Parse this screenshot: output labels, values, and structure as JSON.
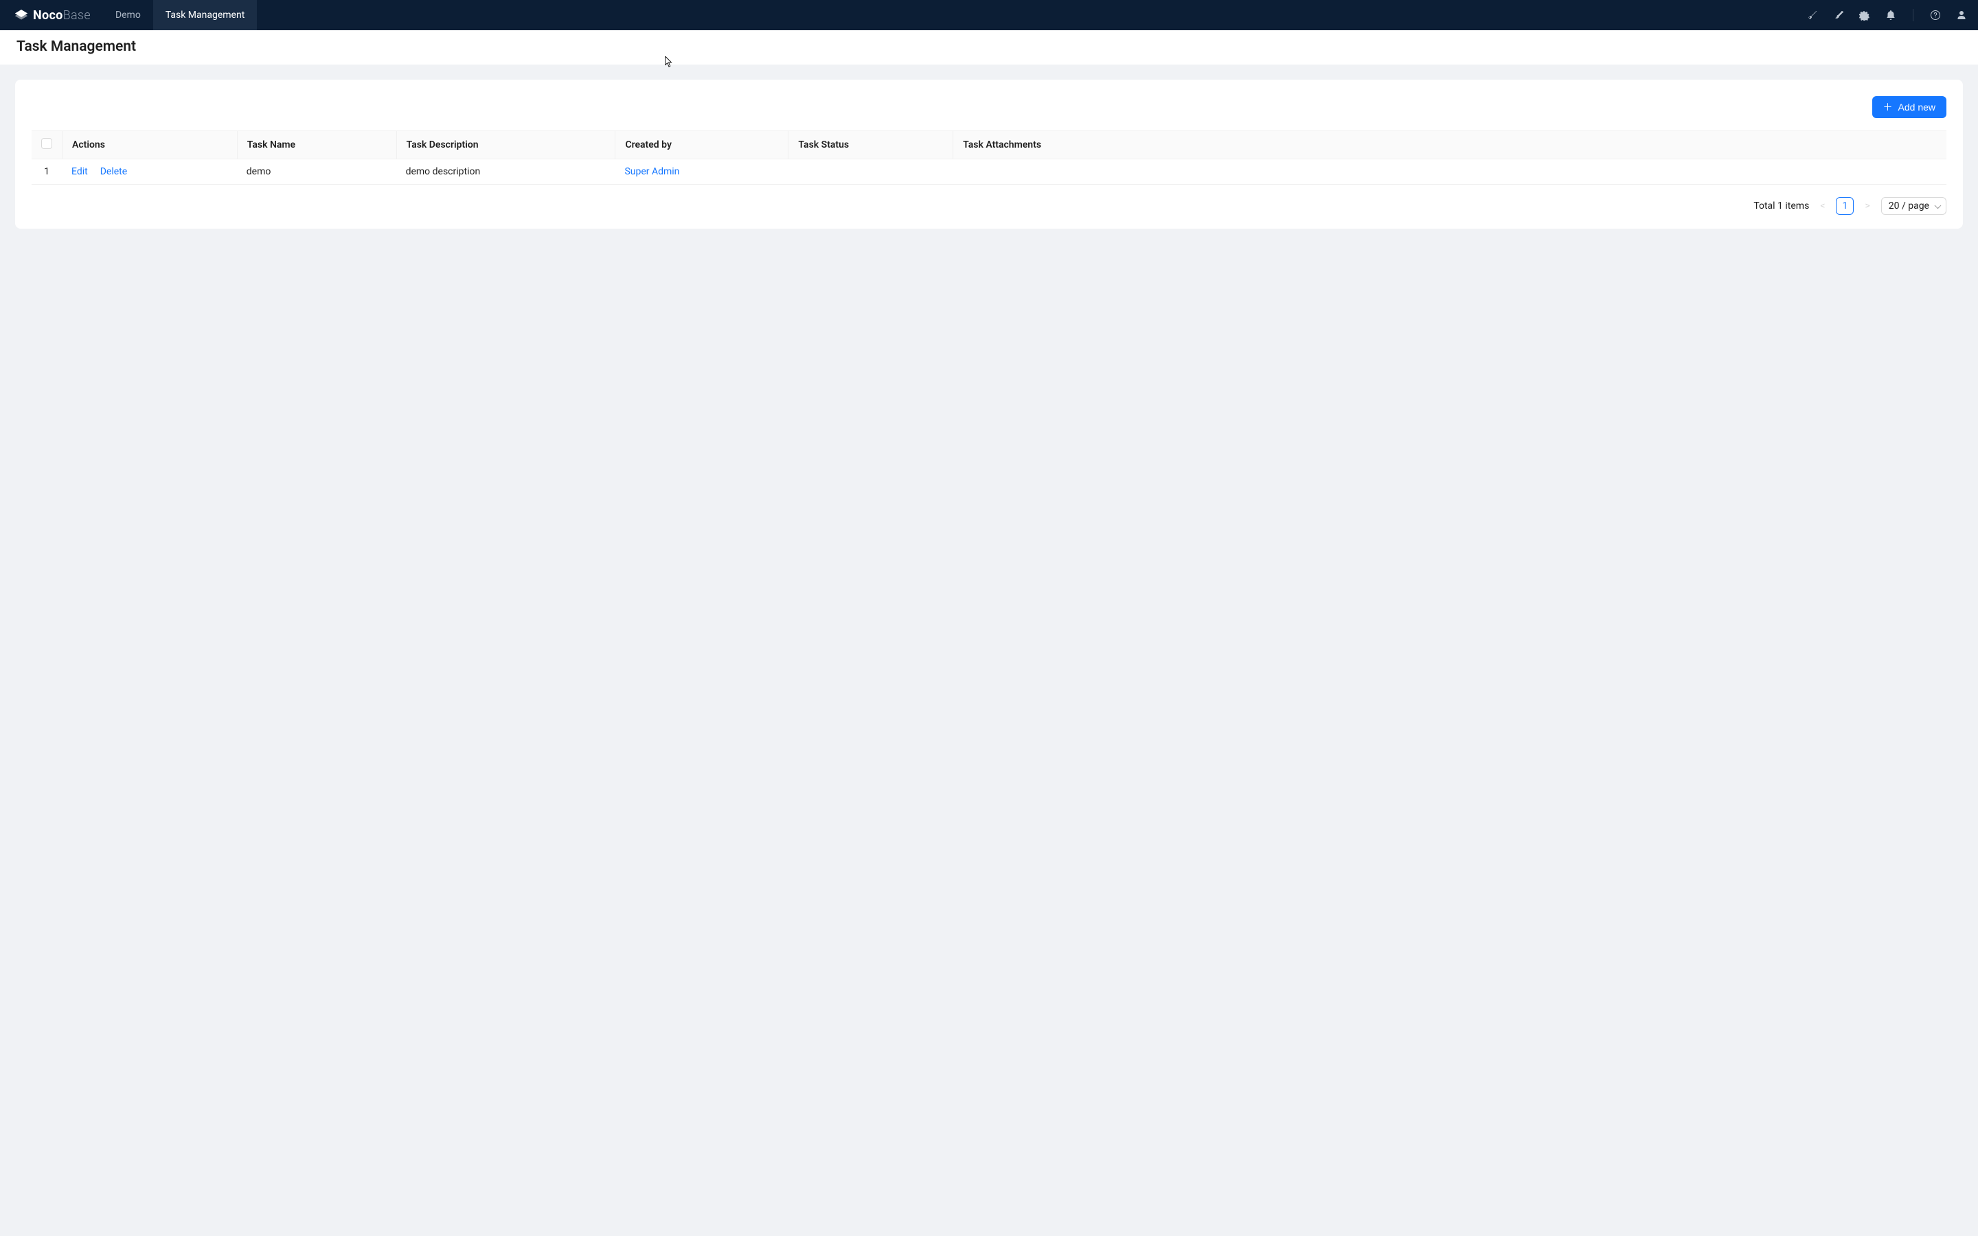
{
  "brand": {
    "bold": "Noco",
    "light": "Base"
  },
  "nav": {
    "items": [
      {
        "label": "Demo",
        "active": false
      },
      {
        "label": "Task Management",
        "active": true
      }
    ]
  },
  "page": {
    "title": "Task Management"
  },
  "toolbar": {
    "add_label": "Add new"
  },
  "table": {
    "columns": [
      "Actions",
      "Task Name",
      "Task Description",
      "Created by",
      "Task Status",
      "Task Attachments"
    ],
    "action_labels": {
      "edit": "Edit",
      "delete": "Delete"
    },
    "rows": [
      {
        "index": "1",
        "name": "demo",
        "description": "demo description",
        "created_by": "Super Admin",
        "status": "",
        "attachments": ""
      }
    ]
  },
  "pager": {
    "total_text": "Total 1 items",
    "current": "1",
    "page_size": "20 / page"
  }
}
